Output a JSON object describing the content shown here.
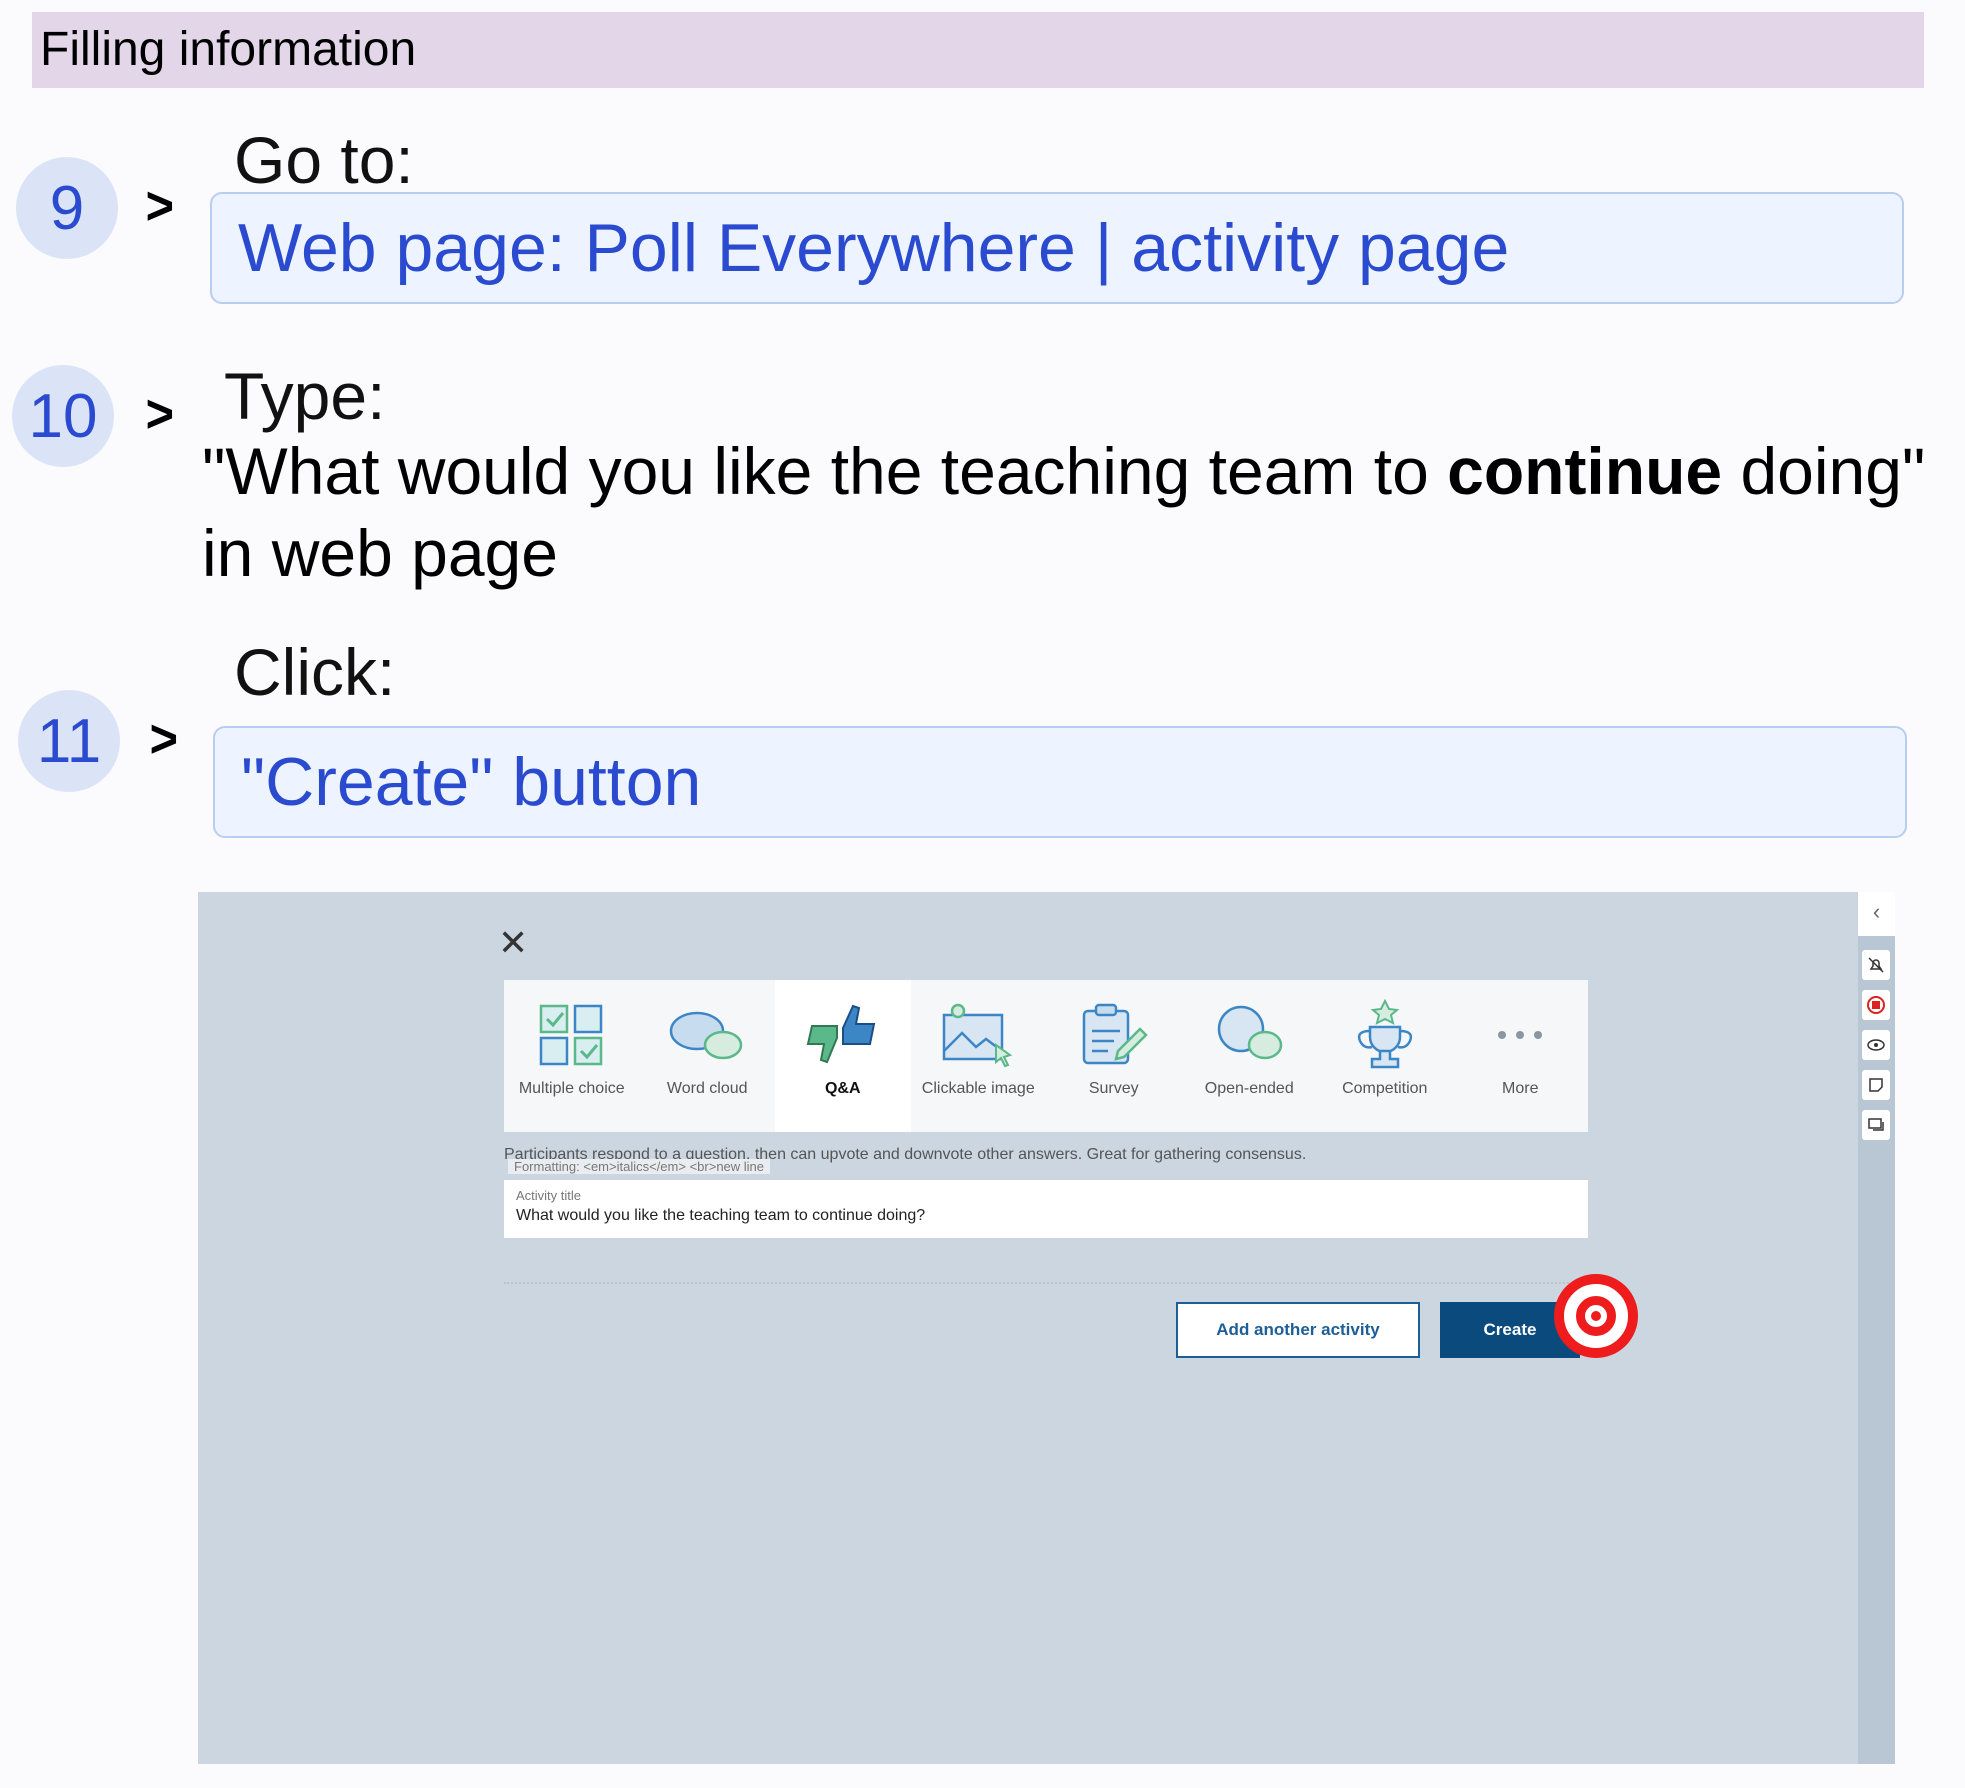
{
  "header": {
    "title": "Filling information"
  },
  "steps": [
    {
      "num": "9",
      "action": "Go to:",
      "target": "Web page: Poll Everywhere | activity page"
    },
    {
      "num": "10",
      "action": "Type:",
      "text_before": "\"What would you like the teaching team to ",
      "text_bold": "continue",
      "text_after": " doing\"",
      "text_line2": "in web page"
    },
    {
      "num": "11",
      "action": "Click:",
      "target": "\"Create\" button"
    }
  ],
  "chevron": ">",
  "screenshot": {
    "close_glyph": "✕",
    "activity_types": [
      {
        "label": "Multiple choice",
        "icon": "multiple-choice-icon"
      },
      {
        "label": "Word cloud",
        "icon": "word-cloud-icon"
      },
      {
        "label": "Q&A",
        "icon": "thumbs-up-down-icon",
        "active": true
      },
      {
        "label": "Clickable image",
        "icon": "clickable-image-icon"
      },
      {
        "label": "Survey",
        "icon": "survey-clipboard-icon"
      },
      {
        "label": "Open-ended",
        "icon": "open-ended-bubble-icon"
      },
      {
        "label": "Competition",
        "icon": "trophy-icon"
      },
      {
        "label": "More",
        "icon": "more-dots-icon"
      }
    ],
    "description": "Participants respond to a question, then can upvote and downvote other answers. Great for gathering consensus.",
    "formatting_hint": "Formatting: <em>italics</em> <br>new line",
    "activity_title_label": "Activity title",
    "activity_title_value": "What would you like the teaching team to continue doing?",
    "add_another_label": "Add another activity",
    "create_label": "Create",
    "rail_collapse_glyph": "‹",
    "target_color": "#ee1c1c"
  }
}
